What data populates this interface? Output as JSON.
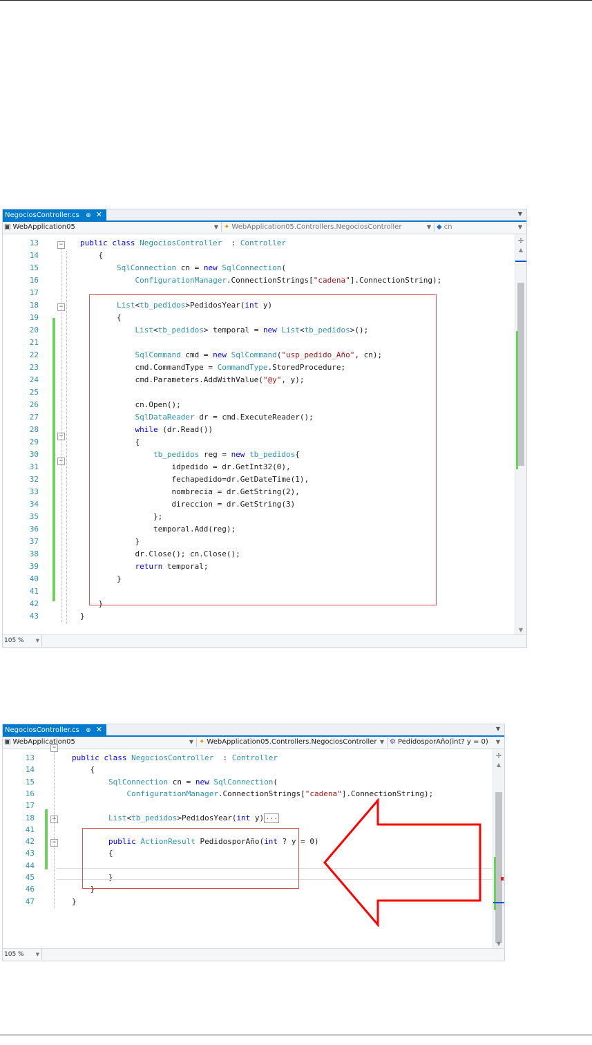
{
  "editor1": {
    "tab": {
      "filename": "NegociosController.cs",
      "pin": "⊕",
      "close": "✕"
    },
    "nav": {
      "project": "WebApplication05",
      "class": "WebApplication05.Controllers.NegociosController",
      "member": "cn"
    },
    "zoom": "105 %",
    "lines": [
      {
        "n": "13",
        "segs": [
          [
            "kw",
            "public class "
          ],
          [
            "ty",
            "NegociosController"
          ],
          [
            "",
            "  : "
          ],
          [
            "ty",
            "Controller"
          ]
        ]
      },
      {
        "n": "14",
        "segs": [
          [
            "",
            "    {"
          ]
        ]
      },
      {
        "n": "15",
        "segs": [
          [
            "",
            "        "
          ],
          [
            "ty",
            "SqlConnection"
          ],
          [
            "",
            " cn = "
          ],
          [
            "kw",
            "new "
          ],
          [
            "ty",
            "SqlConnection"
          ],
          [
            "",
            "("
          ]
        ]
      },
      {
        "n": "16",
        "segs": [
          [
            "",
            "            "
          ],
          [
            "ty",
            "ConfigurationManager"
          ],
          [
            "",
            ".ConnectionStrings["
          ],
          [
            "st",
            "\"cadena\""
          ],
          [
            "",
            "].ConnectionString);"
          ]
        ]
      },
      {
        "n": "17",
        "segs": [
          [
            "",
            ""
          ]
        ]
      },
      {
        "n": "18",
        "segs": [
          [
            "",
            "        "
          ],
          [
            "ty",
            "List"
          ],
          [
            "",
            "<"
          ],
          [
            "ty",
            "tb_pedidos"
          ],
          [
            "",
            ">PedidosYear("
          ],
          [
            "kw",
            "int"
          ],
          [
            "",
            " y)"
          ]
        ]
      },
      {
        "n": "19",
        "segs": [
          [
            "",
            "        {"
          ]
        ]
      },
      {
        "n": "20",
        "segs": [
          [
            "",
            "            "
          ],
          [
            "ty",
            "List"
          ],
          [
            "",
            "<"
          ],
          [
            "ty",
            "tb_pedidos"
          ],
          [
            "",
            "> temporal = "
          ],
          [
            "kw",
            "new "
          ],
          [
            "ty",
            "List"
          ],
          [
            "",
            "<"
          ],
          [
            "ty",
            "tb_pedidos"
          ],
          [
            "",
            ">();"
          ]
        ]
      },
      {
        "n": "21",
        "segs": [
          [
            "",
            ""
          ]
        ]
      },
      {
        "n": "22",
        "segs": [
          [
            "",
            "            "
          ],
          [
            "ty",
            "SqlCommand"
          ],
          [
            "",
            " cmd = "
          ],
          [
            "kw",
            "new "
          ],
          [
            "ty",
            "SqlCommand"
          ],
          [
            "",
            "("
          ],
          [
            "st",
            "\"usp_pedido_Año\""
          ],
          [
            "",
            ", cn);"
          ]
        ]
      },
      {
        "n": "23",
        "segs": [
          [
            "",
            "            cmd.CommandType = "
          ],
          [
            "ty",
            "CommandType"
          ],
          [
            "",
            ".StoredProcedure;"
          ]
        ]
      },
      {
        "n": "24",
        "segs": [
          [
            "",
            "            cmd.Parameters.AddWithValue("
          ],
          [
            "st",
            "\"@y\""
          ],
          [
            "",
            ", y);"
          ]
        ]
      },
      {
        "n": "25",
        "segs": [
          [
            "",
            ""
          ]
        ]
      },
      {
        "n": "26",
        "segs": [
          [
            "",
            "            cn.Open();"
          ]
        ]
      },
      {
        "n": "27",
        "segs": [
          [
            "",
            "            "
          ],
          [
            "ty",
            "SqlDataReader"
          ],
          [
            "",
            " dr = cmd.ExecuteReader();"
          ]
        ]
      },
      {
        "n": "28",
        "segs": [
          [
            "",
            "            "
          ],
          [
            "kw",
            "while"
          ],
          [
            "",
            " (dr.Read())"
          ]
        ]
      },
      {
        "n": "29",
        "segs": [
          [
            "",
            "            {"
          ]
        ]
      },
      {
        "n": "30",
        "segs": [
          [
            "",
            "                "
          ],
          [
            "ty",
            "tb_pedidos"
          ],
          [
            "",
            " reg = "
          ],
          [
            "kw",
            "new "
          ],
          [
            "ty",
            "tb_pedidos"
          ],
          [
            "",
            "{"
          ]
        ]
      },
      {
        "n": "31",
        "segs": [
          [
            "",
            "                    idpedido = dr.GetInt32(0),"
          ]
        ]
      },
      {
        "n": "32",
        "segs": [
          [
            "",
            "                    fechapedido=dr.GetDateTime(1),"
          ]
        ]
      },
      {
        "n": "33",
        "segs": [
          [
            "",
            "                    nombrecia = dr.GetString(2),"
          ]
        ]
      },
      {
        "n": "34",
        "segs": [
          [
            "",
            "                    direccion = dr.GetString(3)"
          ]
        ]
      },
      {
        "n": "35",
        "segs": [
          [
            "",
            "                };"
          ]
        ]
      },
      {
        "n": "36",
        "segs": [
          [
            "",
            "                temporal.Add(reg);"
          ]
        ]
      },
      {
        "n": "37",
        "segs": [
          [
            "",
            "            }"
          ]
        ]
      },
      {
        "n": "38",
        "segs": [
          [
            "",
            "            dr.Close(); cn.Close();"
          ]
        ]
      },
      {
        "n": "39",
        "segs": [
          [
            "",
            "            "
          ],
          [
            "kw",
            "return"
          ],
          [
            "",
            " temporal;"
          ]
        ]
      },
      {
        "n": "40",
        "segs": [
          [
            "",
            "        }"
          ]
        ]
      },
      {
        "n": "41",
        "segs": [
          [
            "",
            ""
          ]
        ]
      },
      {
        "n": "42",
        "segs": [
          [
            "",
            "    }"
          ]
        ]
      },
      {
        "n": "43",
        "segs": [
          [
            "",
            "}"
          ]
        ]
      }
    ]
  },
  "editor2": {
    "tab": {
      "filename": "NegociosController.cs",
      "pin": "⊕",
      "close": "✕"
    },
    "nav": {
      "project": "WebApplication05",
      "class": "WebApplication05.Controllers.NegociosController",
      "member": "PedidosporAño(int? y = 0)"
    },
    "zoom": "105 %",
    "collapsed_marker": "...",
    "lines": [
      {
        "n": "13",
        "segs": [
          [
            "kw",
            "public class "
          ],
          [
            "ty",
            "NegociosController"
          ],
          [
            "",
            "  : "
          ],
          [
            "ty",
            "Controller"
          ]
        ]
      },
      {
        "n": "14",
        "segs": [
          [
            "",
            "    {"
          ]
        ]
      },
      {
        "n": "15",
        "segs": [
          [
            "",
            "        "
          ],
          [
            "ty",
            "SqlConnection"
          ],
          [
            "",
            " cn = "
          ],
          [
            "kw",
            "new "
          ],
          [
            "ty",
            "SqlConnection"
          ],
          [
            "",
            "("
          ]
        ]
      },
      {
        "n": "16",
        "segs": [
          [
            "",
            "            "
          ],
          [
            "ty",
            "ConfigurationManager"
          ],
          [
            "",
            ".ConnectionStrings["
          ],
          [
            "st",
            "\"cadena\""
          ],
          [
            "",
            "].ConnectionString);"
          ]
        ]
      },
      {
        "n": "17",
        "segs": [
          [
            "",
            ""
          ]
        ]
      },
      {
        "n": "18",
        "segs": [
          [
            "",
            "        "
          ],
          [
            "ty",
            "List"
          ],
          [
            "",
            "<"
          ],
          [
            "ty",
            "tb_pedidos"
          ],
          [
            "",
            ">PedidosYear("
          ],
          [
            "kw",
            "int"
          ],
          [
            "",
            " y)"
          ]
        ]
      },
      {
        "n": "41",
        "segs": [
          [
            "",
            ""
          ]
        ]
      },
      {
        "n": "42",
        "segs": [
          [
            "",
            "        "
          ],
          [
            "kw",
            "public "
          ],
          [
            "ty",
            "ActionResult"
          ],
          [
            "",
            " PedidosporAño("
          ],
          [
            "kw",
            "int"
          ],
          [
            "",
            " ? y = 0)"
          ]
        ]
      },
      {
        "n": "43",
        "segs": [
          [
            "",
            "        {"
          ]
        ]
      },
      {
        "n": "44",
        "segs": [
          [
            "",
            ""
          ]
        ]
      },
      {
        "n": "45",
        "segs": [
          [
            "",
            "        }"
          ]
        ]
      },
      {
        "n": "46",
        "segs": [
          [
            "",
            "    }"
          ]
        ]
      },
      {
        "n": "47",
        "segs": [
          [
            "",
            "}"
          ]
        ]
      }
    ]
  },
  "colors": {
    "keyword": "#0000ff",
    "type": "#2b91af",
    "string": "#a31515",
    "tab_active": "#007acc",
    "change_bar": "#6bd35b",
    "highlight_box": "#e05050",
    "arrow": "#ff0000"
  }
}
